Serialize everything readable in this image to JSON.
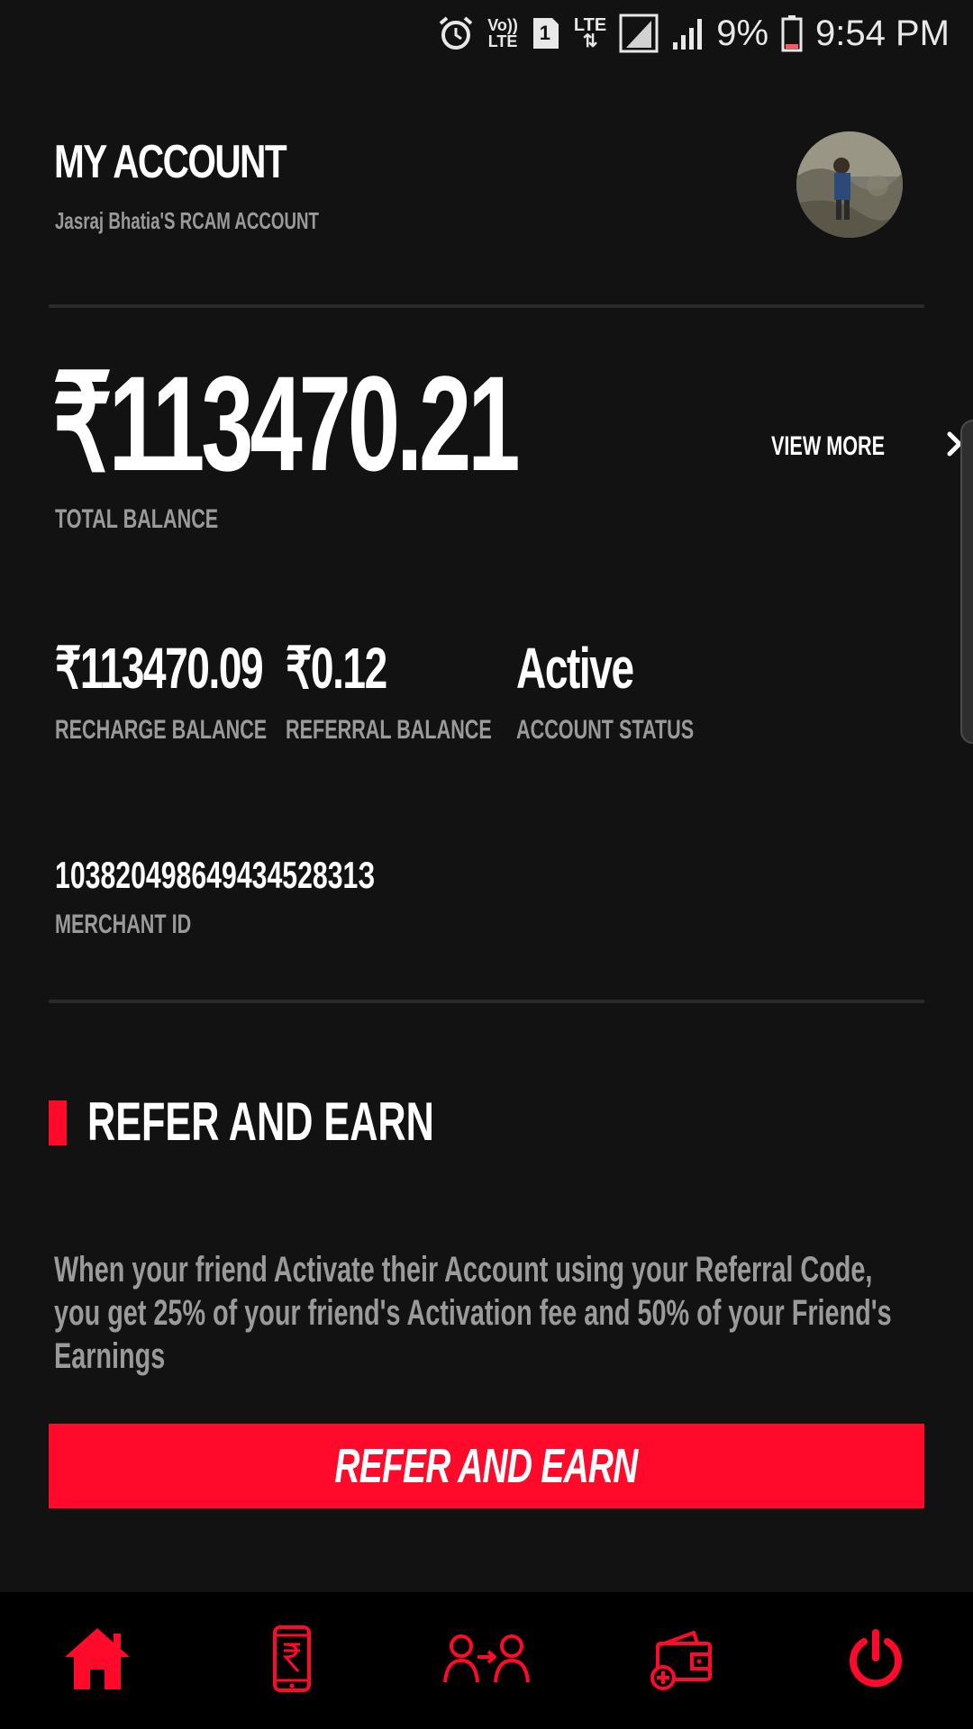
{
  "status_bar": {
    "battery_percent": "9%",
    "time": "9:54 PM",
    "volte_label": "Vo))",
    "lte_label": "LTE",
    "sim_number": "1",
    "icons": [
      "alarm-icon",
      "volte-icon",
      "sim-icon",
      "lte-data-icon",
      "signal-icon",
      "signal-icon",
      "battery-icon"
    ]
  },
  "header": {
    "title": "MY ACCOUNT",
    "subtitle": "Jasraj Bhatia'S RCAM ACCOUNT"
  },
  "balance": {
    "total_value": "₹113470.21",
    "total_label": "TOTAL BALANCE",
    "view_more_label": "VIEW MORE"
  },
  "stats": [
    {
      "value": "₹113470.09",
      "label": "RECHARGE BALANCE"
    },
    {
      "value": "₹0.12",
      "label": "REFERRAL BALANCE"
    },
    {
      "value": "Active",
      "label": "ACCOUNT STATUS"
    }
  ],
  "merchant": {
    "id": "10382049864943452831З",
    "label": "MERCHANT ID"
  },
  "refer": {
    "section_title": "REFER AND EARN",
    "description": " When your friend Activate their Account using your Referral Code, you get 25% of your friend's Activation fee and 50% of your Friend's Earnings",
    "button_label": "REFER AND EARN"
  },
  "bottom_nav": {
    "items": [
      "home-icon",
      "mobile-recharge-icon",
      "transfer-users-icon",
      "wallet-add-icon",
      "power-icon"
    ]
  },
  "colors": {
    "background": "#121212",
    "accent": "#ff0a2a",
    "muted_text": "#9a9a9a",
    "nav_background": "#000000"
  }
}
